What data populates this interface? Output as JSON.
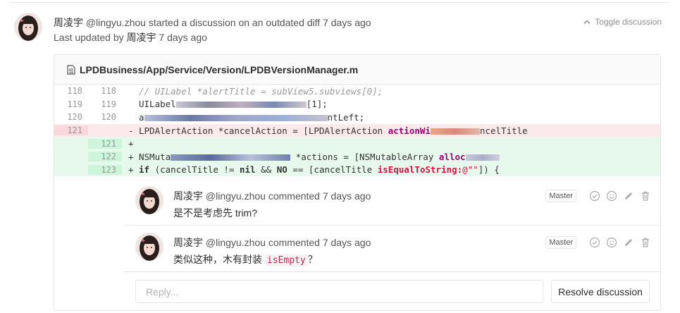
{
  "discussion": {
    "author_name": "周凌宇",
    "author_handle": "@lingyu.zhou",
    "action_text": "started a discussion on an outdated diff",
    "time": "7 days ago",
    "updated_prefix": "Last updated by",
    "updated_by": "周凌宇",
    "updated_time": "7 days ago",
    "toggle_label": "Toggle discussion"
  },
  "file": {
    "path": "LPDBusiness/App/Service/Version/LPDBVersionManager.m"
  },
  "diff": {
    "lines": [
      {
        "type": "context",
        "old": "118",
        "new": "118"
      },
      {
        "type": "context",
        "old": "119",
        "new": "119"
      },
      {
        "type": "context",
        "old": "120",
        "new": "120"
      },
      {
        "type": "removed",
        "old": "121",
        "new": "",
        "sign": "-"
      },
      {
        "type": "added",
        "old": "",
        "new": "121",
        "sign": "+"
      },
      {
        "type": "added",
        "old": "",
        "new": "122",
        "sign": "+"
      },
      {
        "type": "added",
        "old": "",
        "new": "123",
        "sign": "+"
      }
    ],
    "code": {
      "l118": "//    UILabel *alertTitle = subView5.subviews[0];",
      "l119_a": "UILabel",
      "l119_b": "[1];",
      "l120_a": "a",
      "l120_b": "ntLeft;",
      "l121old_a": "LPDAlertAction *cancelAction = [LPDAlertAction",
      "l121old_b": "actionWi",
      "l121old_c": "ncelTitle",
      "l122_a": "NSMuta",
      "l122_b": "*actions = [NSMutableArray",
      "l122_c": "alloc",
      "l123_if": "if",
      "l123_a": "(cancelTitle !=",
      "l123_nil": "nil",
      "l123_b": "&&",
      "l123_no": "NO",
      "l123_c": "== [cancelTitle",
      "l123_method": "isEqualToString:",
      "l123_str": "@\"\"",
      "l123_d": "]) {"
    }
  },
  "notes": [
    {
      "author_name": "周凌宇",
      "author_handle": "@lingyu.zhou",
      "action": "commented",
      "time": "7 days ago",
      "badge": "Master",
      "body": "是不是考虑先 trim?"
    },
    {
      "author_name": "周凌宇",
      "author_handle": "@lingyu.zhou",
      "action": "commented",
      "time": "7 days ago",
      "badge": "Master",
      "body_prefix": "类似这种，木有封装 ",
      "body_code": "isEmpty",
      "body_suffix": "？"
    }
  ],
  "reply": {
    "placeholder": "Reply...",
    "resolve_label": "Resolve discussion"
  },
  "icons": {
    "toggle": "chevron-up-icon",
    "file": "file-icon",
    "resolve": "check-circle-icon",
    "emoji": "smiley-icon",
    "edit": "pencil-icon",
    "delete": "trash-icon"
  }
}
